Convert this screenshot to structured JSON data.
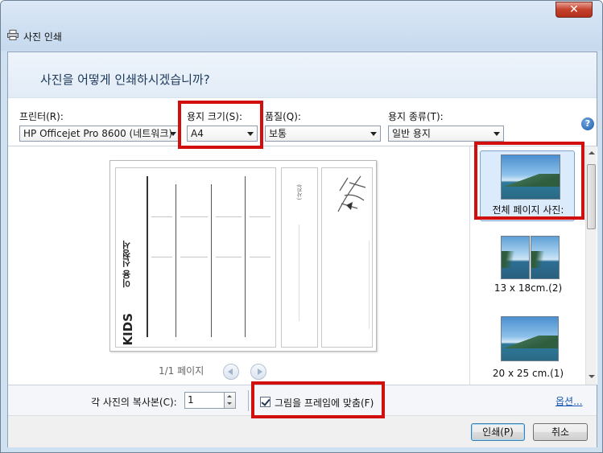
{
  "window": {
    "title": "사진 인쇄",
    "close_label": "✕"
  },
  "header": {
    "question": "사진을 어떻게 인쇄하시겠습니까?"
  },
  "options": {
    "printer": {
      "label": "프린터(R):",
      "value": "HP Officejet Pro 8600 (네트워크)"
    },
    "paper_size": {
      "label": "용지 크기(S):",
      "value": "A4"
    },
    "quality": {
      "label": "품질(Q):",
      "value": "보통"
    },
    "paper_type": {
      "label": "용지 종류(T):",
      "value": "일반 용지"
    },
    "help_label": "?"
  },
  "preview": {
    "page_indicator": "1/1 페이지",
    "form_title": "이용 신청서",
    "brand": "KIDS",
    "side_label": "(사진)"
  },
  "layouts": [
    {
      "label": "전체 페이지 사진:",
      "selected": true
    },
    {
      "label": "13 x 18cm.(2)",
      "selected": false
    },
    {
      "label": "20 x 25 cm.(1)",
      "selected": false
    }
  ],
  "bottom": {
    "copies_label": "각 사진의 복사본(C):",
    "copies_value": "1",
    "fit_label": "그림을 프레임에 맞춤(F)",
    "fit_checked": true,
    "options_link": "옵션..."
  },
  "footer": {
    "print_label": "인쇄(P)",
    "cancel_label": "취소"
  },
  "colors": {
    "highlight": "#d20f0f",
    "link": "#1a56b3",
    "header_text": "#1e395b"
  }
}
